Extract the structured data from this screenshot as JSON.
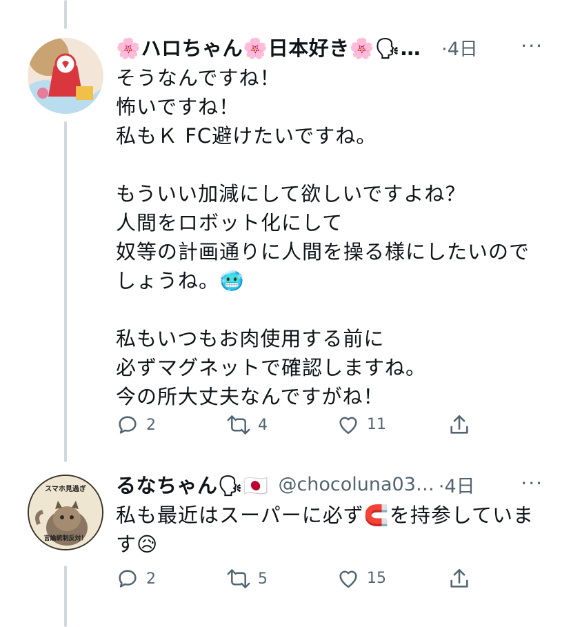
{
  "tweets": [
    {
      "display_name": "🌸ハロちゃん🌸日本好き🌸🗣…",
      "handle": "",
      "time": "·4日",
      "text": "そうなんですね！\n怖いですね！\n私もＫ FC避けたいですね。\n\nもういい加減にして欲しいですよね？\n人間をロボット化にして\n奴等の計画通りに人間を操る様にしたいので\nしょうね。🥶\n\n私もいつもお肉使用する前に\n必ずマグネットで確認しますね。\n今の所大丈夫なんですがね！",
      "counts": {
        "reply": "2",
        "retweet": "4",
        "like": "11"
      }
    },
    {
      "display_name": "るなちゃん🗣🇯🇵",
      "handle": "@chocoluna03…",
      "time": "·4日",
      "text": "私も最近はスーパーに必ず🧲を持参していま\nす😥",
      "counts": {
        "reply": "2",
        "retweet": "5",
        "like": "15"
      },
      "avatar_text_top": "スマホ見過ぎ",
      "avatar_text_bottom": "言論統制反対！"
    }
  ],
  "more_label": "···",
  "colors": {
    "thread_line": "#cfd9de",
    "secondary": "#536471"
  },
  "icons": [
    "reply-icon",
    "retweet-icon",
    "like-icon",
    "share-icon",
    "more-icon"
  ]
}
